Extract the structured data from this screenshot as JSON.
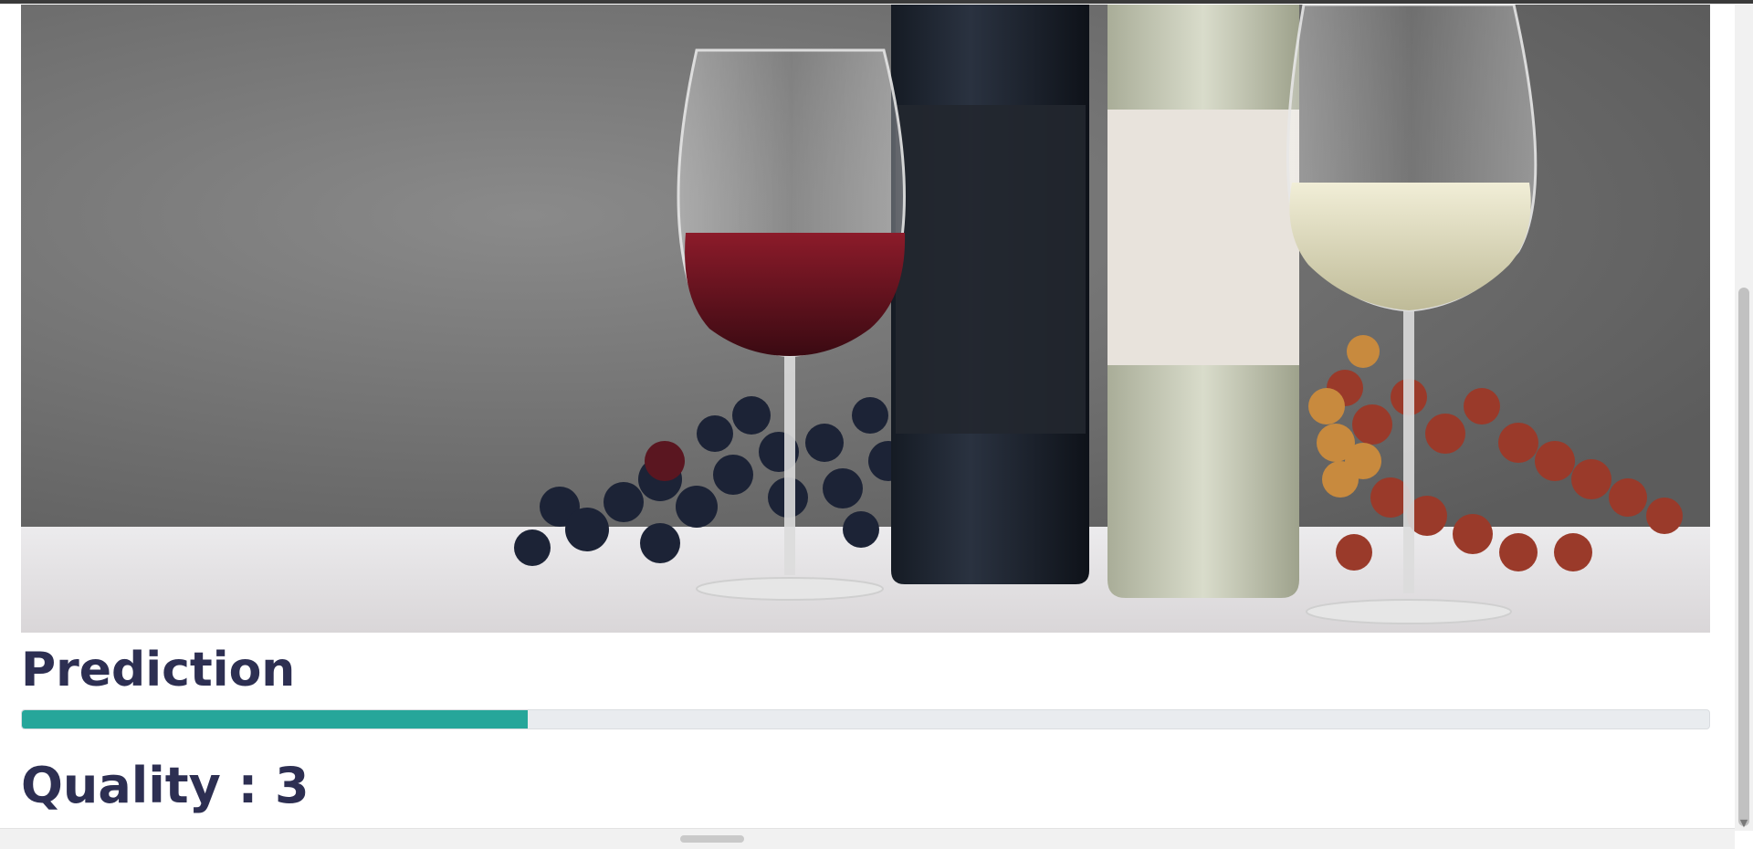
{
  "hero": {
    "alt": "Red and white wine glasses with bottles and grapes"
  },
  "prediction": {
    "heading": "Prediction",
    "progress_percent": 30,
    "quality_text": "Quality : 3"
  },
  "colors": {
    "accent": "#26a69a",
    "heading": "#2d2f52",
    "track": "#e9ecef"
  }
}
